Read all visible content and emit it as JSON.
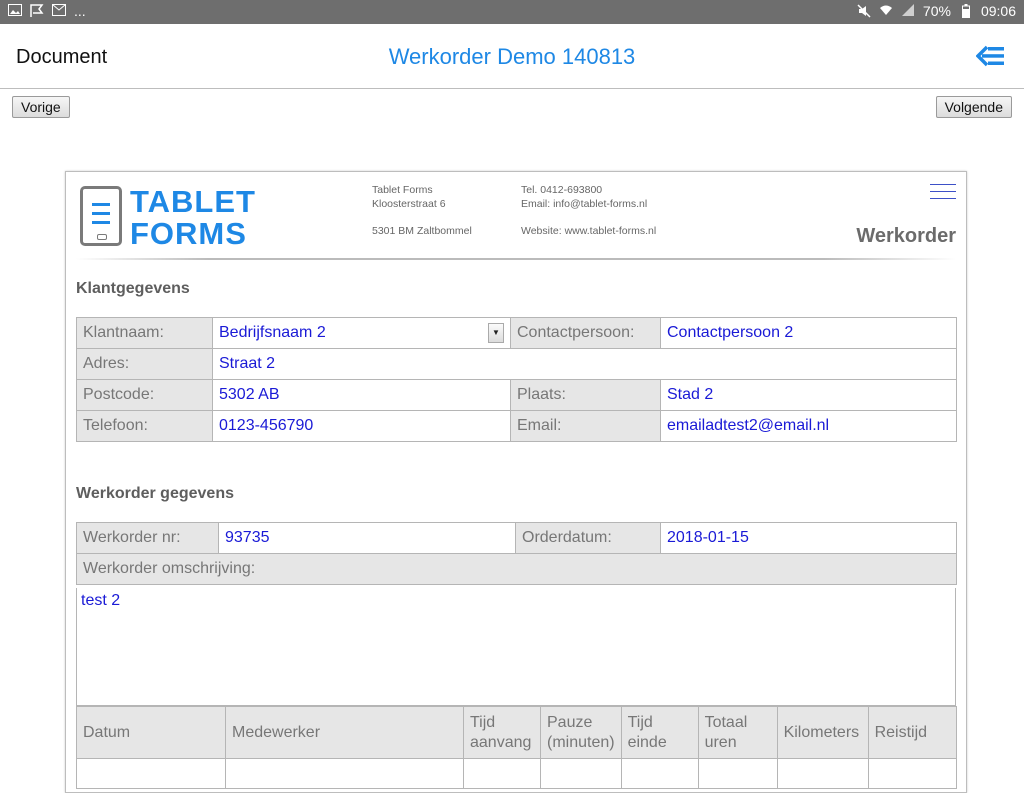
{
  "status_bar": {
    "dots": "...",
    "battery": "70%",
    "time": "09:06"
  },
  "app_bar": {
    "left_title": "Document",
    "center_title": "Werkorder Demo 140813"
  },
  "nav": {
    "prev_label": "Vorige",
    "next_label": "Volgende"
  },
  "doc": {
    "logo_line1": "TABLET",
    "logo_line2": "FORMS",
    "company": {
      "name": "Tablet Forms",
      "street": "Kloosterstraat 6",
      "city": "5301 BM Zaltbommel",
      "tel": "Tel. 0412-693800",
      "email": "Email: info@tablet-forms.nl",
      "website": "Website: www.tablet-forms.nl"
    },
    "title": "Werkorder"
  },
  "klant": {
    "heading": "Klantgegevens",
    "klantnaam_label": "Klantnaam:",
    "klantnaam_value": "Bedrijfsnaam 2",
    "contact_label": "Contactpersoon:",
    "contact_value": "Contactpersoon 2",
    "adres_label": "Adres:",
    "adres_value": "Straat 2",
    "postcode_label": "Postcode:",
    "postcode_value": "5302 AB",
    "plaats_label": "Plaats:",
    "plaats_value": "Stad 2",
    "telefoon_label": "Telefoon:",
    "telefoon_value": "0123-456790",
    "email_label": "Email:",
    "email_value": "emailadtest2@email.nl"
  },
  "werkorder": {
    "heading": "Werkorder gegevens",
    "nr_label": "Werkorder nr:",
    "nr_value": "93735",
    "datum_label": "Orderdatum:",
    "datum_value": "2018-01-15",
    "omschr_label": "Werkorder omschrijving:",
    "omschr_value": "test 2"
  },
  "hours": {
    "columns": [
      "Datum",
      "Medewerker",
      "Tijd aanvang",
      "Pauze (minuten)",
      "Tijd einde",
      "Totaal uren",
      "Kilometers",
      "Reistijd"
    ]
  }
}
